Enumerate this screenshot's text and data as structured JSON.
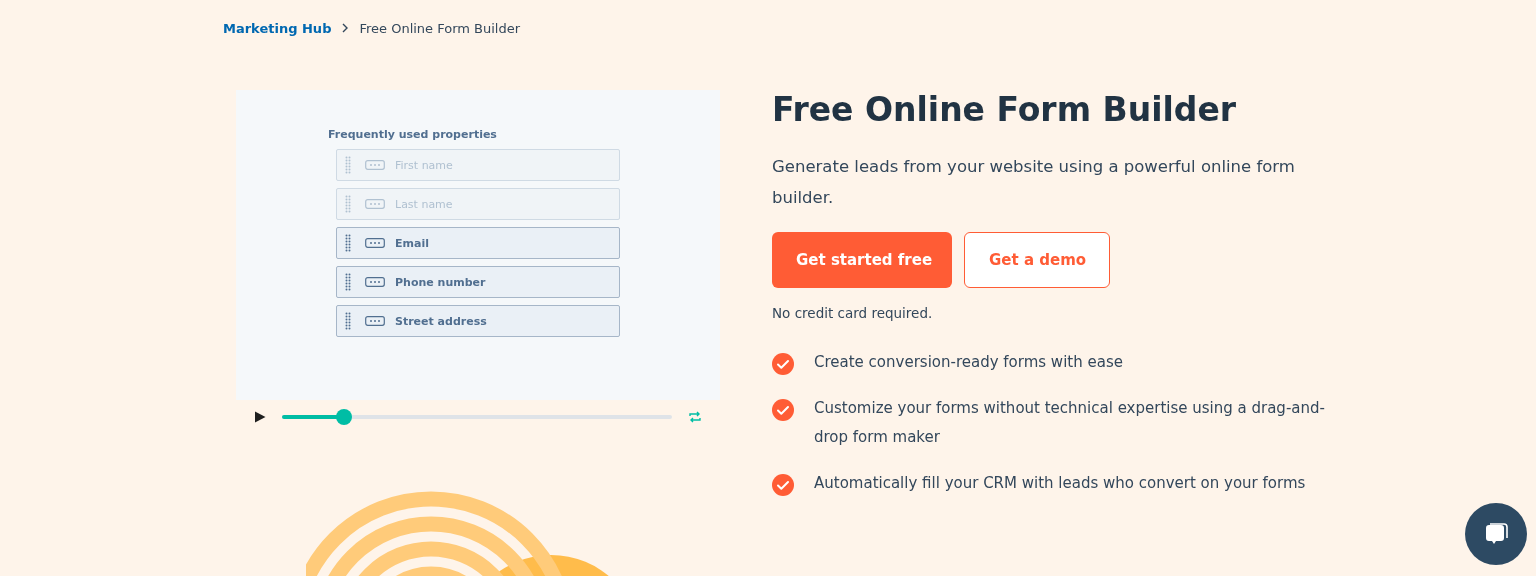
{
  "breadcrumb": {
    "items": [
      {
        "label": "Marketing Hub",
        "kind": "link"
      },
      {
        "label": "Free Online Form Builder",
        "kind": "current"
      }
    ]
  },
  "video": {
    "heading": "Frequently used properties",
    "fields": [
      {
        "label": "First name",
        "dimmed": true
      },
      {
        "label": "Last name",
        "dimmed": true
      },
      {
        "label": "Email",
        "dimmed": false
      },
      {
        "label": "Phone number",
        "dimmed": false
      },
      {
        "label": "Street address",
        "dimmed": false
      }
    ],
    "progress": {
      "level": 0.16
    }
  },
  "hero": {
    "title": "Free Online Form Builder",
    "subtitle": "Generate leads from your website using a powerful online form builder.",
    "buttons": [
      {
        "label": "Get started free",
        "kind": "primary"
      },
      {
        "label": "Get a demo",
        "kind": "secondary"
      }
    ],
    "note": "No credit card required.",
    "features": [
      "Create conversion-ready forms with ease",
      "Customize your forms without technical expertise using a drag-and-drop form maker",
      "Automatically fill your CRM with leads who convert on your forms"
    ]
  }
}
